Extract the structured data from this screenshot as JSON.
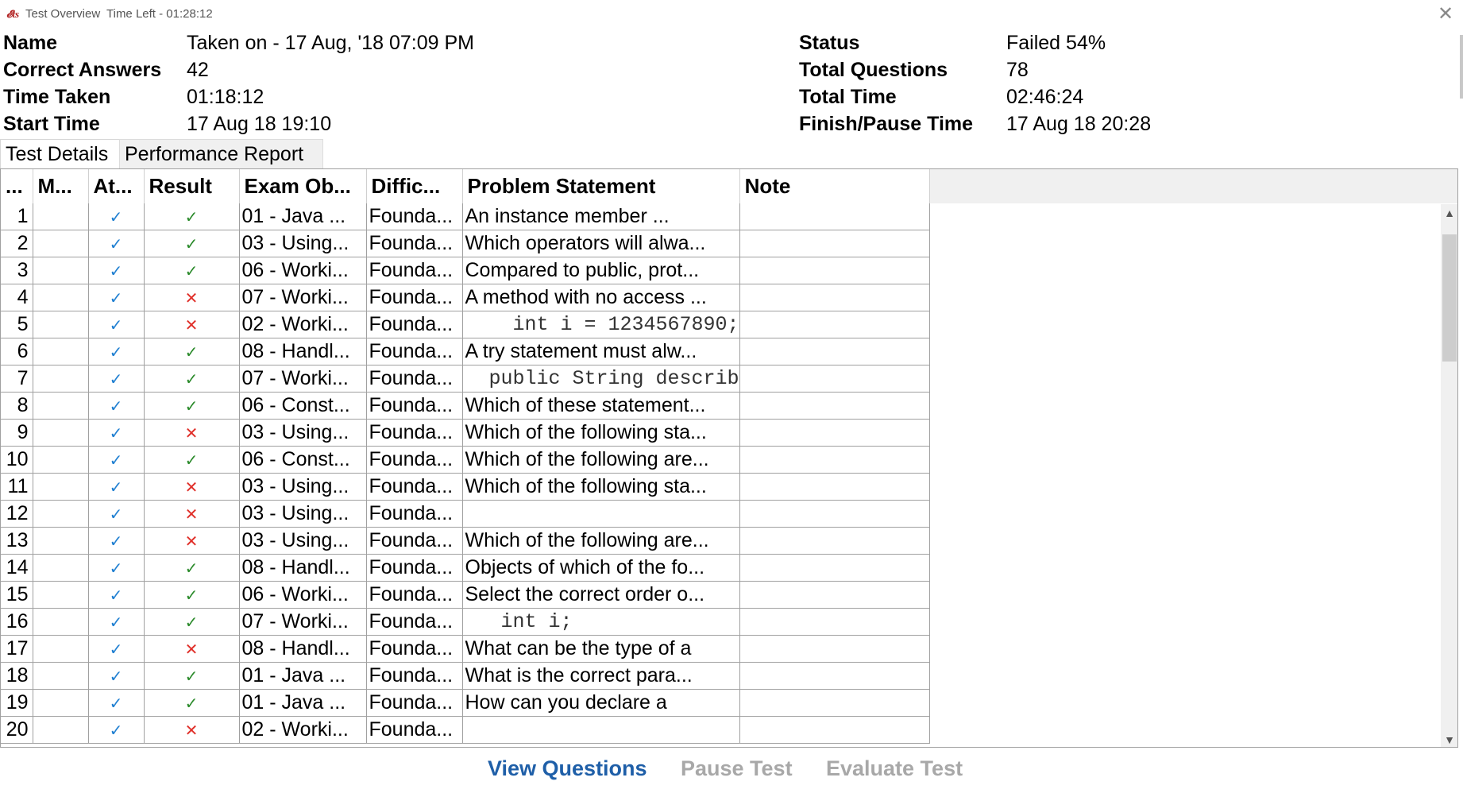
{
  "window": {
    "title": "Test Overview",
    "time_left": "Time Left - 01:28:12",
    "app_icon": "ets-logo-icon",
    "close_icon": "close-icon"
  },
  "summary": {
    "name_label": "Name",
    "name_value": "Taken on - 17 Aug, '18 07:09 PM",
    "correct_label": "Correct Answers",
    "correct_value": "42",
    "time_taken_label": "Time Taken",
    "time_taken_value": "01:18:12",
    "start_label": "Start Time",
    "start_value": "17 Aug 18 19:10",
    "status_label": "Status",
    "status_value": "Failed 54%",
    "total_q_label": "Total Questions",
    "total_q_value": "78",
    "total_time_label": "Total Time",
    "total_time_value": "02:46:24",
    "finish_label": "Finish/Pause Time",
    "finish_value": "17 Aug 18 20:28"
  },
  "tabs": {
    "details": "Test Details",
    "performance": "Performance Report"
  },
  "columns": [
    "...",
    "M...",
    "At...",
    "Result",
    "Exam Ob...",
    "Diffic...",
    "Problem Statement",
    "Note"
  ],
  "glyphs": {
    "check": "✓",
    "cross": "✕",
    "up": "▲",
    "down": "▼"
  },
  "colors": {
    "correct": "#2a8a2a",
    "attempted": "#1f7fd1",
    "wrong": "#e0302a",
    "link": "#1f5fa8"
  },
  "rows": [
    {
      "n": "1",
      "m": "",
      "att": true,
      "res": "correct",
      "obj": "01 - Java ...",
      "diff": "Founda...",
      "prob": "An instance member ...",
      "code": false
    },
    {
      "n": "2",
      "m": "",
      "att": true,
      "res": "correct",
      "obj": "03 - Using...",
      "diff": "Founda...",
      "prob": "Which operators will alwa...",
      "code": false
    },
    {
      "n": "3",
      "m": "",
      "att": true,
      "res": "correct",
      "obj": "06 - Worki...",
      "diff": "Founda...",
      "prob": "Compared to public, prot...",
      "code": false
    },
    {
      "n": "4",
      "m": "",
      "att": true,
      "res": "wrong",
      "obj": "07 - Worki...",
      "diff": "Founda...",
      "prob": "A method with no access ...",
      "code": false
    },
    {
      "n": "5",
      "m": "",
      "att": true,
      "res": "wrong",
      "obj": "02 - Worki...",
      "diff": "Founda...",
      "prob": "    int i = 1234567890;",
      "code": true
    },
    {
      "n": "6",
      "m": "",
      "att": true,
      "res": "correct",
      "obj": "08 - Handl...",
      "diff": "Founda...",
      "prob": "A try statement must alw...",
      "code": false
    },
    {
      "n": "7",
      "m": "",
      "att": true,
      "res": "correct",
      "obj": "07 - Worki...",
      "diff": "Founda...",
      "prob": "  public String describ",
      "code": true
    },
    {
      "n": "8",
      "m": "",
      "att": true,
      "res": "correct",
      "obj": "06 - Const...",
      "diff": "Founda...",
      "prob": "Which of these statement...",
      "code": false
    },
    {
      "n": "9",
      "m": "",
      "att": true,
      "res": "wrong",
      "obj": "03 - Using...",
      "diff": "Founda...",
      "prob": "Which of the following sta...",
      "code": false
    },
    {
      "n": "10",
      "m": "",
      "att": true,
      "res": "correct",
      "obj": "06 - Const...",
      "diff": "Founda...",
      "prob": "Which of the following are...",
      "code": false
    },
    {
      "n": "11",
      "m": "",
      "att": true,
      "res": "wrong",
      "obj": "03 - Using...",
      "diff": "Founda...",
      "prob": "Which of the following sta...",
      "code": false
    },
    {
      "n": "12",
      "m": "",
      "att": true,
      "res": "wrong",
      "obj": "03 - Using...",
      "diff": "Founda...",
      "prob": "",
      "code": false
    },
    {
      "n": "13",
      "m": "",
      "att": true,
      "res": "wrong",
      "obj": "03 - Using...",
      "diff": "Founda...",
      "prob": "Which of the following are...",
      "code": false
    },
    {
      "n": "14",
      "m": "",
      "att": true,
      "res": "correct",
      "obj": "08 - Handl...",
      "diff": "Founda...",
      "prob": "Objects of which of the fo...",
      "code": false
    },
    {
      "n": "15",
      "m": "",
      "att": true,
      "res": "correct",
      "obj": "06 - Worki...",
      "diff": "Founda...",
      "prob": "Select the correct order o...",
      "code": false
    },
    {
      "n": "16",
      "m": "",
      "att": true,
      "res": "correct",
      "obj": "07 - Worki...",
      "diff": "Founda...",
      "prob": "   int i;",
      "code": true
    },
    {
      "n": "17",
      "m": "",
      "att": true,
      "res": "wrong",
      "obj": "08 - Handl...",
      "diff": "Founda...",
      "prob": "What can be the type of a",
      "code": false
    },
    {
      "n": "18",
      "m": "",
      "att": true,
      "res": "correct",
      "obj": "01 - Java ...",
      "diff": "Founda...",
      "prob": "What is the correct para...",
      "code": false
    },
    {
      "n": "19",
      "m": "",
      "att": true,
      "res": "correct",
      "obj": "01 - Java ...",
      "diff": "Founda...",
      "prob": "How can you declare a",
      "code": false
    },
    {
      "n": "20",
      "m": "",
      "att": true,
      "res": "wrong",
      "obj": "02 - Worki...",
      "diff": "Founda...",
      "prob": "",
      "code": false
    }
  ],
  "footer": {
    "view": "View Questions",
    "pause": "Pause Test",
    "evaluate": "Evaluate Test"
  }
}
